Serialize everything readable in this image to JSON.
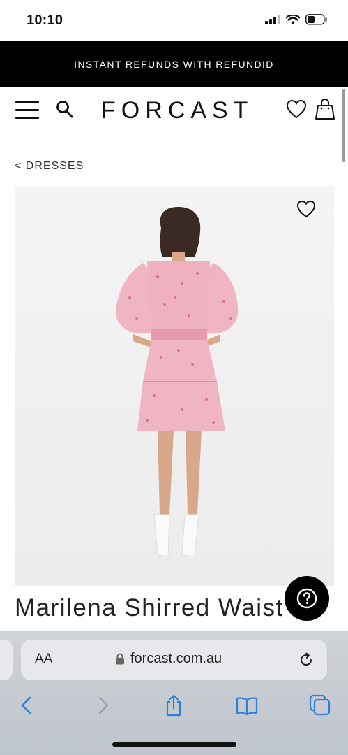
{
  "status_bar": {
    "time": "10:10"
  },
  "promo": {
    "text": "INSTANT REFUNDS WITH REFUNDID"
  },
  "header": {
    "logo": "FORCAST"
  },
  "breadcrumb": {
    "label": "< DRESSES"
  },
  "product": {
    "title": "Marilena Shirred Waist",
    "image_alt": "Model wearing pink floral dress, back view"
  },
  "browser": {
    "text_size_label": "AA",
    "url": "forcast.com.au"
  },
  "colors": {
    "promo_bg": "#000000",
    "accent_blue": "#2f7fd8",
    "dress_pink": "#e9a6b7"
  }
}
